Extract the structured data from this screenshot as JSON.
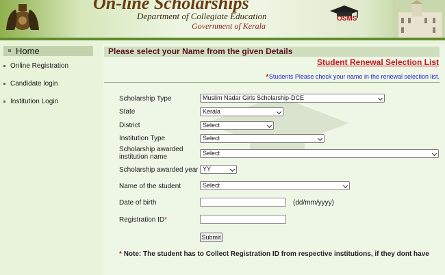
{
  "header": {
    "title": "On-line Scholarships",
    "department": "Department of Collegiate Education",
    "government": "Government of Kerala",
    "logo_text": "OSMS"
  },
  "sidebar": {
    "home": "Home",
    "items": [
      {
        "label": "Online Registration"
      },
      {
        "label": "Candidate login"
      },
      {
        "label": "Institution Login"
      }
    ]
  },
  "main": {
    "heading": "Please select your Name from the given Details",
    "renewal_link": "Student Renewal Selection List",
    "notice_star": "*",
    "notice": "Students Please check your name in the renewal selection list."
  },
  "form": {
    "scholarship_type": {
      "label": "Scholarship Type",
      "value": "Muslim Nadar Girls Scholarship-DCE"
    },
    "state": {
      "label": "State",
      "value": "Kerala"
    },
    "district": {
      "label": "District",
      "value": "Select"
    },
    "institution_type": {
      "label": "Institution Type",
      "value": "Select"
    },
    "institution_name": {
      "label_line1": "Scholarship awarded",
      "label_line2": "institution name",
      "value": "Select"
    },
    "award_year": {
      "label": "Scholarship awarded year",
      "value": "YY"
    },
    "student_name": {
      "label": "Name of the student",
      "value": "Select"
    },
    "dob": {
      "label": "Date of birth",
      "value": "",
      "format_hint": "(dd/mm/yyyy)"
    },
    "registration_id": {
      "label": "Registration ID",
      "required_mark": "*",
      "value": ""
    },
    "submit_label": "Submit"
  },
  "note": {
    "mark": "*",
    "text": "Note: The student has to Collect Registration ID from respective institutions, if they dont have"
  },
  "colors": {
    "accent": "#5f8c2d",
    "heading": "#5a0e2a",
    "link": "#c0181c",
    "notice": "#1f22c9"
  }
}
